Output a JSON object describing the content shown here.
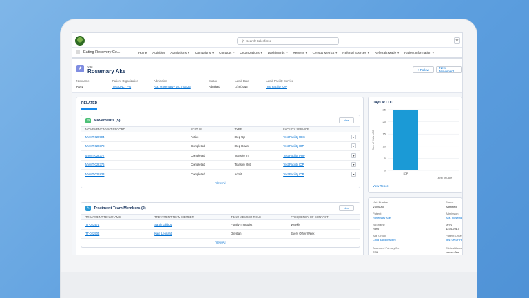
{
  "app": {
    "name": "Eating Recovery Ce...",
    "search_placeholder": "Search Salesforce"
  },
  "nav": [
    {
      "label": "Home",
      "has_menu": false
    },
    {
      "label": "Activities",
      "has_menu": false
    },
    {
      "label": "Admissions",
      "has_menu": true
    },
    {
      "label": "Campaigns",
      "has_menu": true
    },
    {
      "label": "Contacts",
      "has_menu": true
    },
    {
      "label": "Organizations",
      "has_menu": true
    },
    {
      "label": "Dashboards",
      "has_menu": true
    },
    {
      "label": "Reports",
      "has_menu": true
    },
    {
      "label": "Census Metrics",
      "has_menu": true
    },
    {
      "label": "Referral Sources",
      "has_menu": true
    },
    {
      "label": "Referrals Made",
      "has_menu": true
    },
    {
      "label": "Patient Information",
      "has_menu": true
    }
  ],
  "record": {
    "type": "Visit",
    "title": "Rosemary Ake",
    "follow_label": "+ Follow",
    "new_movement_label": "New Movement",
    "fields": [
      {
        "label": "Nickname",
        "value": "Rosy",
        "link": false
      },
      {
        "label": "Patient Organization",
        "value": "Test ONLY Pts",
        "link": true
      },
      {
        "label": "Admission",
        "value": "Ake, Rosemary - 2017-05-26",
        "link": true
      },
      {
        "label": "Status",
        "value": "Admitted",
        "link": false
      },
      {
        "label": "Admit Date",
        "value": "1/29/2018",
        "link": false
      },
      {
        "label": "Admit Facility Service",
        "value": "Test Facility IOP",
        "link": true
      }
    ]
  },
  "related_tab": "RELATED",
  "movements": {
    "title": "Movements (5)",
    "new_label": "New",
    "columns": [
      "MOVEMENT: MVMT RECORD",
      "STATUS",
      "TYPE",
      "FACILITY SERVICE"
    ],
    "rows": [
      [
        "MVMT-022904",
        "Active",
        "Step Up",
        "Test Facility RES"
      ],
      [
        "MVMT-022378",
        "Completed",
        "Step Down",
        "Test Facility IOP"
      ],
      [
        "MVMT-022377",
        "Completed",
        "Transfer In",
        "Test Facility PHP"
      ],
      [
        "MVMT-022376",
        "Completed",
        "Transfer Out",
        "Test Facility IOP"
      ],
      [
        "MVMT-021833",
        "Completed",
        "Admit",
        "Test Facility IOP"
      ]
    ],
    "view_all": "View All"
  },
  "team": {
    "title": "Treatment Team Members (2)",
    "new_label": "New",
    "columns": [
      "TREATMENT TEAM NAME",
      "TREATMENT TEAM MEMBER",
      "TEAM MEMBER ROLE",
      "FREQUENCY OF CONTACT"
    ],
    "rows": [
      [
        "TT-023474",
        "Sarah Gildroy",
        "Family Therapist",
        "Weekly"
      ],
      [
        "TT-022904",
        "Kate Leonard",
        "Dietitian",
        "Every Other Week"
      ]
    ],
    "view_all": "View All"
  },
  "chart_panel": {
    "title": "Days at LOC",
    "view_report": "View Report"
  },
  "chart_data": {
    "type": "bar",
    "categories": [
      "IOP"
    ],
    "values": [
      25
    ],
    "ylim": [
      0,
      25
    ],
    "yticks": [
      0,
      5,
      10,
      15,
      20,
      25
    ],
    "ylabel": "Sum of Visits LOC",
    "xlabel": "Level of Care",
    "bar_color": "#1b9ad6",
    "grid": true
  },
  "info_panel": {
    "left": [
      {
        "label": "Visit Number",
        "value": "V-026065",
        "link": false
      },
      {
        "label": "Patient",
        "value": "Rosemary Ake",
        "link": true
      },
      {
        "label": "Nickname",
        "value": "Rosy",
        "link": false
      },
      {
        "label": "Age Group",
        "value": "Child & Adolescent",
        "link": true
      },
      {
        "label": "Assessed Primary Dx",
        "value": "EED",
        "link": false
      }
    ],
    "right": [
      {
        "label": "Status",
        "value": "Admitted",
        "link": false
      },
      {
        "label": "Admission",
        "value": "Ake, Rosema",
        "link": true
      },
      {
        "label": "MRN",
        "value": "1234-291.5",
        "link": false
      },
      {
        "label": "Patient Organiz",
        "value": "Test ONLY Pt",
        "link": true
      },
      {
        "label": "Clinical Associ",
        "value": "Lauren Ake",
        "link": false
      }
    ]
  },
  "colors": {
    "accent": "#0070d2",
    "brand_header": "#16325c",
    "record_icon": "#7f8de1",
    "movement_icon": "#4bc076",
    "team_icon": "#2a9ad6"
  }
}
